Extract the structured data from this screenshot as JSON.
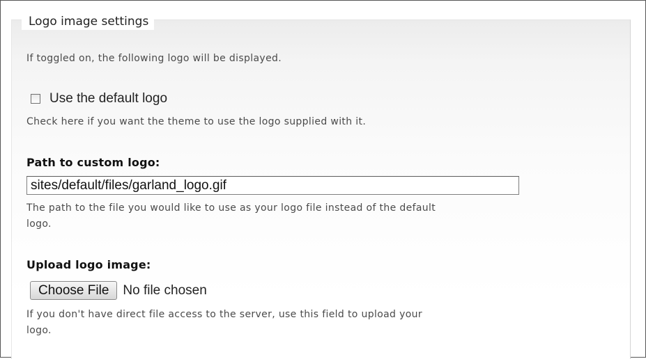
{
  "fieldset": {
    "legend": "Logo image settings",
    "intro": "If toggled on, the following logo will be displayed."
  },
  "default_logo": {
    "checkbox_label": "Use the default logo",
    "checked": false,
    "description": "Check here if you want the theme to use the logo supplied with it."
  },
  "custom_path": {
    "label": "Path to custom logo:",
    "value": "sites/default/files/garland_logo.gif",
    "description_line1": "The path to the file you would like to use as your logo file instead of the default",
    "description_line2": "logo."
  },
  "upload": {
    "label": "Upload logo image:",
    "button_label": "Choose File",
    "status": "No file chosen",
    "description_line1": "If you don't have direct file access to the server, use this field to upload your",
    "description_line2": "logo."
  }
}
